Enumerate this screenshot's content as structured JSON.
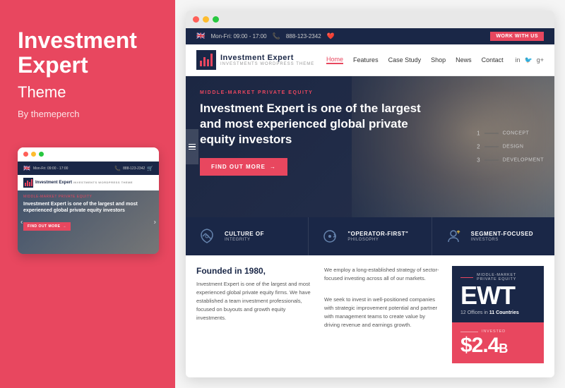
{
  "leftPanel": {
    "title": "Investment Expert",
    "titleLine1": "Investment",
    "titleLine2": "Expert",
    "subtitle": "Theme",
    "author": "By themeperch"
  },
  "mobilePreview": {
    "topBar": {
      "dots": [
        "red",
        "yellow",
        "green"
      ]
    },
    "topInfo": {
      "hours": "Mon-Fri: 09:00 - 17:00",
      "phone": "888-123-2342"
    },
    "logo": "Investment Expert",
    "heroLabel": "MIDDLE-MARKET PRIVATE EQUITY",
    "heroTitle": "Investment Expert is one of the largest and most experienced global private equity investors",
    "ctaButton": "FIND OUT MORE",
    "navItems": [
      "<",
      ">"
    ]
  },
  "browser": {
    "topBar": {
      "hours": "Mon-Fri: 09:00 - 17:00",
      "phone": "888-123-2342",
      "workBtn": "WORK WITH US"
    },
    "navbar": {
      "logoMain": "Investment Expert",
      "logoSub": "INVESTMENTS WORDPRESS THEME",
      "navItems": [
        "Home",
        "Features",
        "Case Study",
        "Shop",
        "News",
        "Contact"
      ],
      "socialItems": [
        "in",
        "🐦",
        "g+"
      ]
    },
    "hero": {
      "label": "MIDDLE-MARKET PRIVATE EQUITY",
      "title": "Investment Expert is one of the largest and most experienced global private equity investors",
      "ctaButton": "FIND OUT MORE",
      "sideNav": [
        {
          "num": "1",
          "label": "CONCEPT"
        },
        {
          "num": "2",
          "label": "DESIGN"
        },
        {
          "num": "3",
          "label": "DEVELOPMENT"
        }
      ]
    },
    "features": [
      {
        "icon": "handshake",
        "title": "CULTURE OF",
        "subtitle": "INTEGRITY"
      },
      {
        "icon": "cycle",
        "title": "\"OPERATOR-FIRST\"",
        "subtitle": "PHILOSOPHY"
      },
      {
        "icon": "user-star",
        "title": "SEGMENT-FOCUSED",
        "subtitle": "INVESTORS"
      }
    ],
    "content": {
      "leftTitle": "Founded in 1980,",
      "leftText": "Investment Expert is one of the largest and most experienced global private equity firms. We have established a team investment professionals, focused on buyouts and growth equity investments.",
      "middleText": "We employ a long-established strategy of sector-focused investing across all of our markets.\n\nWe seek to invest in well-positioned companies with strategic improvement potential and partner with management teams to create value by driving revenue and earnings growth."
    },
    "stats": [
      {
        "sectionLabel": "MIDDLE-MARKET PRIVATE EQUITY",
        "value": "EWT",
        "description": "12 Offices in 11 Countries"
      },
      {
        "sectionLabel": "INVESTED",
        "value": "$2.4",
        "suffix": "B"
      }
    ]
  }
}
